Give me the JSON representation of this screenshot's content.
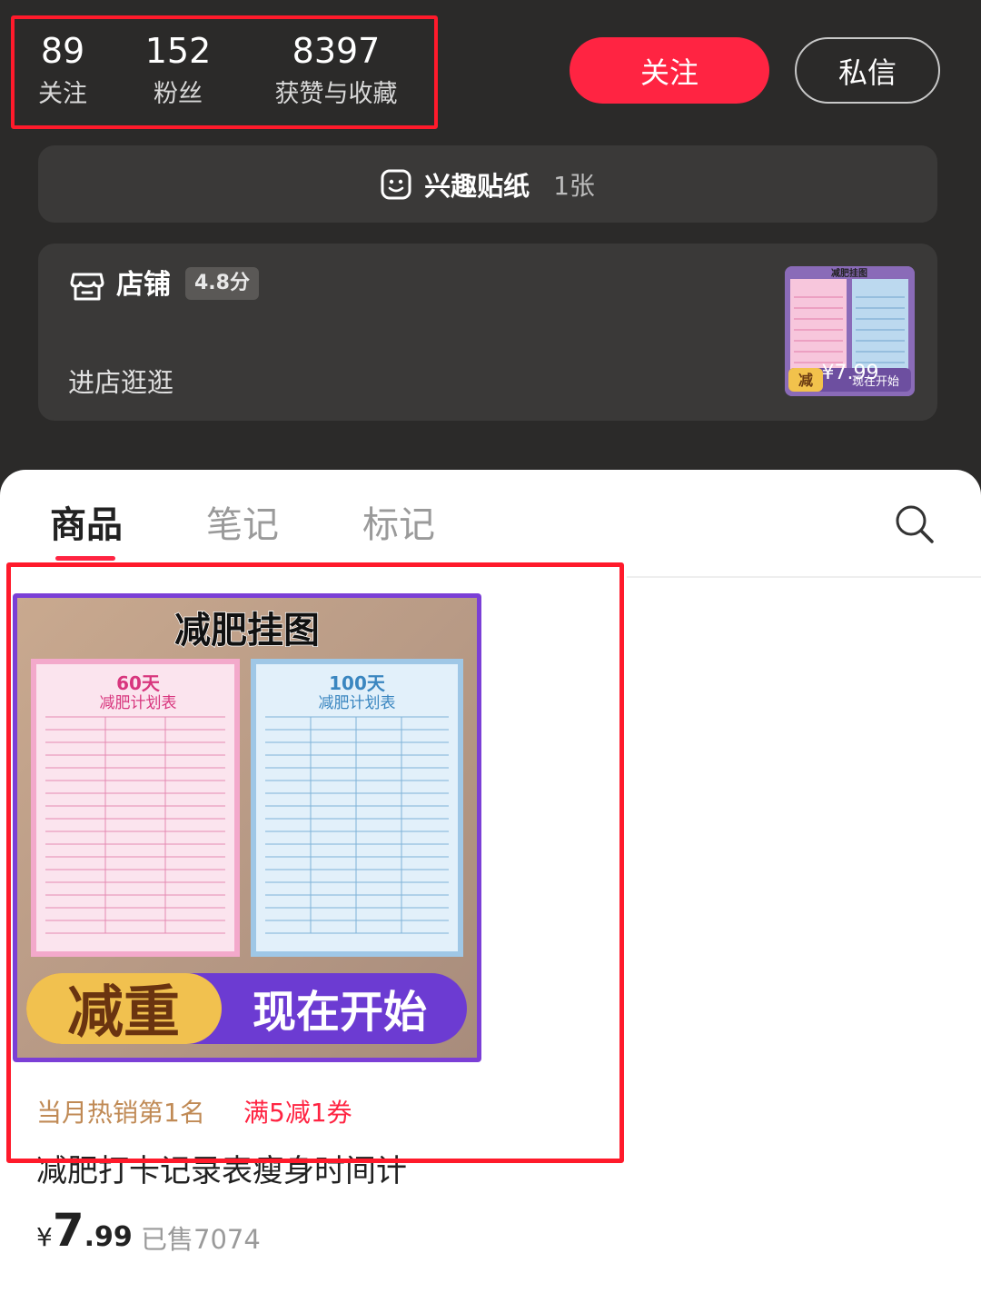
{
  "profile": {
    "stats": [
      {
        "value": "89",
        "label": "关注"
      },
      {
        "value": "152",
        "label": "粉丝"
      },
      {
        "value": "8397",
        "label": "获赞与收藏"
      }
    ],
    "follow_label": "关注",
    "message_label": "私信"
  },
  "sticker": {
    "label": "兴趣贴纸",
    "count": "1张"
  },
  "shop": {
    "title": "店铺",
    "score": "4.8分",
    "enter_label": "进店逛逛",
    "thumb_title": "减肥挂图",
    "thumb_price": "¥7.99",
    "thumb_tag_left": "减",
    "thumb_tag_right": "现在开始"
  },
  "tabs": [
    {
      "label": "商品",
      "active": true
    },
    {
      "label": "笔记",
      "active": false
    },
    {
      "label": "标记",
      "active": false
    }
  ],
  "product": {
    "poster_title": "减肥挂图",
    "chart_left_days": "60天",
    "chart_left_sub": "减肥计划表",
    "chart_right_days": "100天",
    "chart_right_sub": "减肥计划表",
    "banner_left": "减重",
    "banner_right": "现在开始",
    "tag_hot": "当月热销第1名",
    "tag_coupon": "满5减1券",
    "title": "减肥打卡记录表瘦身时间计",
    "price_symbol": "¥",
    "price_int": "7",
    "price_dec": ".99",
    "sold": "已售7074"
  },
  "colors": {
    "accent": "#ff2442",
    "highlight_box": "#ff1a2b",
    "dark_bg": "#2b2a29",
    "card_bg": "#3a3938"
  }
}
